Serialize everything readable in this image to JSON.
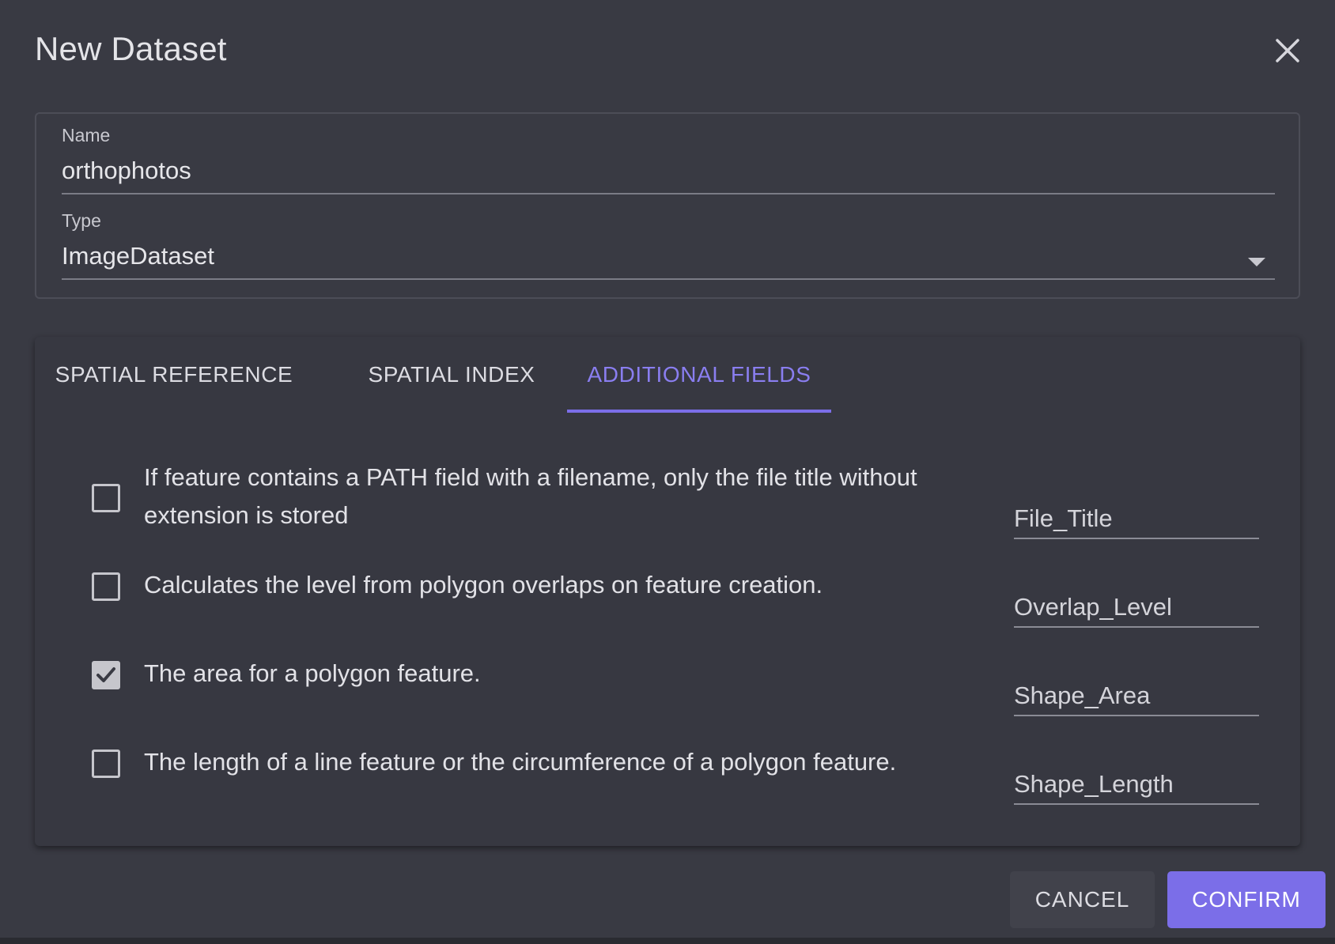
{
  "dialog": {
    "title": "New Dataset",
    "close_icon": "close-icon"
  },
  "form": {
    "name": {
      "label": "Name",
      "value": "orthophotos"
    },
    "type": {
      "label": "Type",
      "value": "ImageDataset",
      "icon": "dropdown-arrow-icon"
    }
  },
  "tabs": [
    {
      "label": "SPATIAL REFERENCE",
      "active": false
    },
    {
      "label": "SPATIAL INDEX",
      "active": false
    },
    {
      "label": "ADDITIONAL FIELDS",
      "active": true
    }
  ],
  "additional_fields": [
    {
      "checked": false,
      "description": "If feature contains a PATH field with a filename, only the file title without extension is stored",
      "field_name": "File_Title"
    },
    {
      "checked": false,
      "description": "Calculates the level from polygon overlaps on feature creation.",
      "field_name": "Overlap_Level"
    },
    {
      "checked": true,
      "description": "The area for a polygon feature.",
      "field_name": "Shape_Area"
    },
    {
      "checked": false,
      "description": "The length of a line feature or the circumference of a polygon feature.",
      "field_name": "Shape_Length"
    }
  ],
  "actions": {
    "cancel_label": "CANCEL",
    "confirm_label": "CONFIRM"
  },
  "colors": {
    "accent": "#7b6ee8",
    "background": "#393a43"
  }
}
